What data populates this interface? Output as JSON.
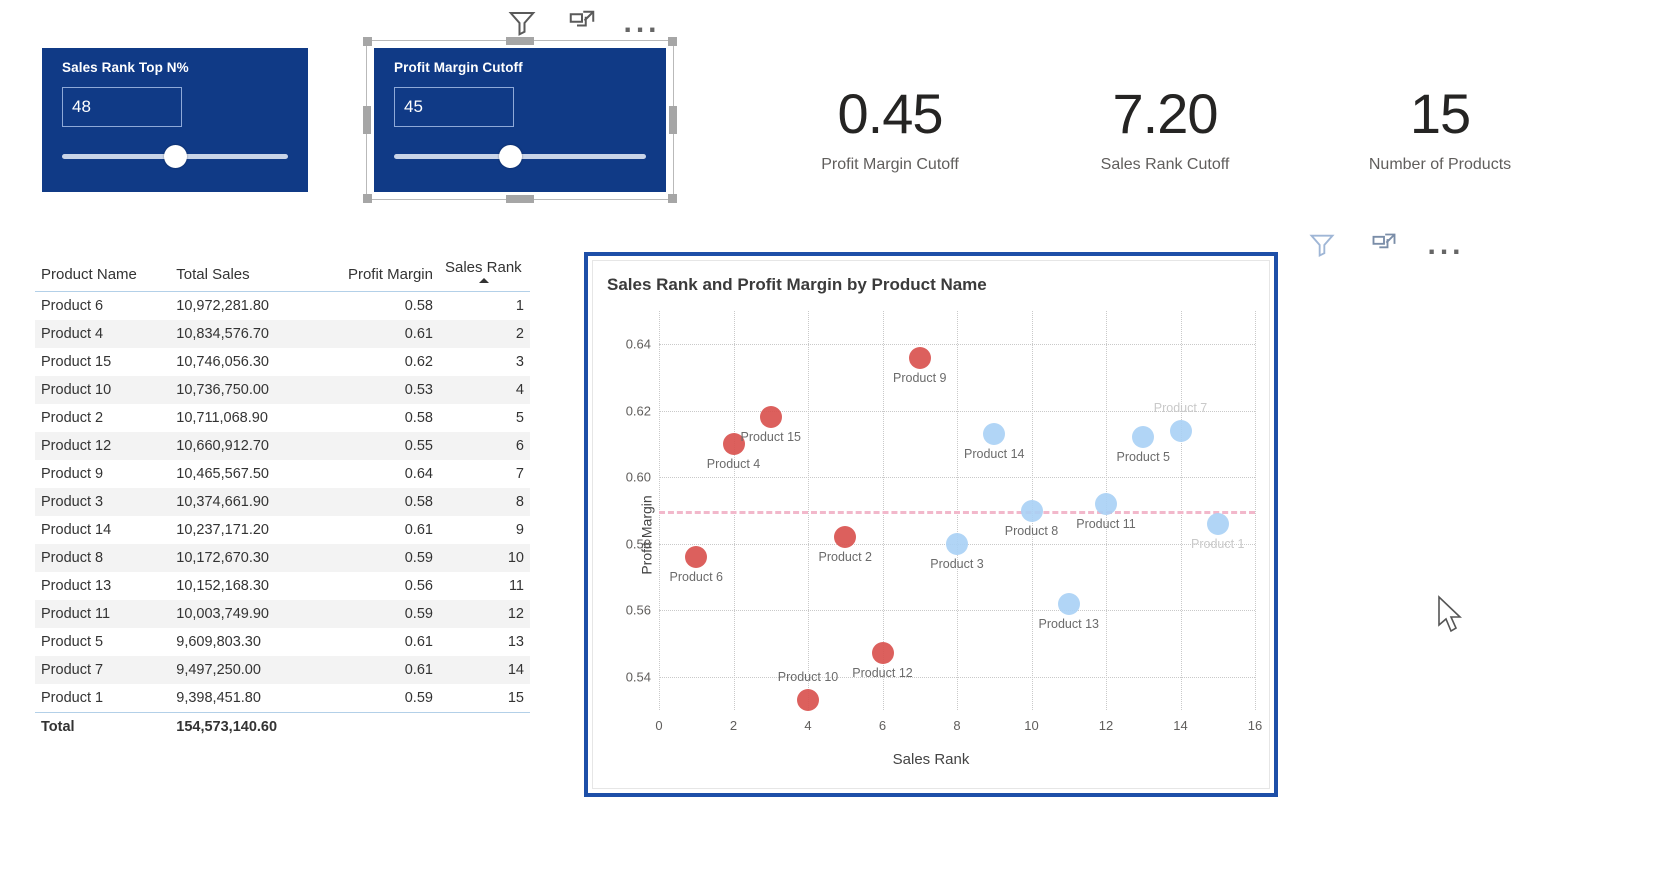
{
  "slicers": [
    {
      "title": "Sales Rank Top N%",
      "value": "48",
      "knob_pct": 50,
      "selected": false
    },
    {
      "title": "Profit Margin Cutoff",
      "value": "45",
      "knob_pct": 46,
      "selected": true
    }
  ],
  "slicer_toolbar": {
    "filter_icon": "filter-icon",
    "focus_icon": "focus-mode-icon",
    "more_icon": "more-options-icon",
    "more_label": "..."
  },
  "chart_toolbar": {
    "filter_icon": "filter-icon",
    "focus_icon": "focus-mode-icon",
    "more_label": "..."
  },
  "kpis": [
    {
      "value": "0.45",
      "label": "Profit Margin Cutoff"
    },
    {
      "value": "7.20",
      "label": "Sales Rank Cutoff"
    },
    {
      "value": "15",
      "label": "Number of Products"
    }
  ],
  "table": {
    "columns": [
      "Product Name",
      "Total Sales",
      "Profit Margin",
      "Sales Rank"
    ],
    "sorted_column": "Sales Rank",
    "sort_direction": "asc",
    "rows": [
      [
        "Product 6",
        "10,972,281.80",
        "0.58",
        "1"
      ],
      [
        "Product 4",
        "10,834,576.70",
        "0.61",
        "2"
      ],
      [
        "Product 15",
        "10,746,056.30",
        "0.62",
        "3"
      ],
      [
        "Product 10",
        "10,736,750.00",
        "0.53",
        "4"
      ],
      [
        "Product 2",
        "10,711,068.90",
        "0.58",
        "5"
      ],
      [
        "Product 12",
        "10,660,912.70",
        "0.55",
        "6"
      ],
      [
        "Product 9",
        "10,465,567.50",
        "0.64",
        "7"
      ],
      [
        "Product 3",
        "10,374,661.90",
        "0.58",
        "8"
      ],
      [
        "Product 14",
        "10,237,171.20",
        "0.61",
        "9"
      ],
      [
        "Product 8",
        "10,172,670.30",
        "0.59",
        "10"
      ],
      [
        "Product 13",
        "10,152,168.30",
        "0.56",
        "11"
      ],
      [
        "Product 11",
        "10,003,749.90",
        "0.59",
        "12"
      ],
      [
        "Product 5",
        "9,609,803.30",
        "0.61",
        "13"
      ],
      [
        "Product 7",
        "9,497,250.00",
        "0.61",
        "14"
      ],
      [
        "Product 1",
        "9,398,451.80",
        "0.59",
        "15"
      ]
    ],
    "total": {
      "label": "Total",
      "total_sales": "154,573,140.60",
      "profit_margin": "",
      "sales_rank": ""
    }
  },
  "chart_data": {
    "type": "scatter",
    "title": "Sales Rank and Profit Margin by Product Name",
    "xlabel": "Sales Rank",
    "ylabel": "Profit Margin",
    "xlim": [
      0,
      16
    ],
    "ylim": [
      0.53,
      0.65
    ],
    "xticks": [
      0,
      2,
      4,
      6,
      8,
      10,
      12,
      14,
      16
    ],
    "yticks": [
      0.54,
      0.56,
      0.58,
      0.6,
      0.62,
      0.64
    ],
    "grid": true,
    "legend": "none",
    "reference_line": {
      "value": 0.59,
      "color": "#f2b8cb",
      "style": "dashed",
      "label": "Profit Margin Cutoff"
    },
    "colors": {
      "above_cutoff": "#d9534f",
      "below_cutoff": "#a9d0f5"
    },
    "points": [
      {
        "label": "Product 6",
        "x": 1,
        "y": 0.576,
        "group": "above_cutoff",
        "label_pos": "below"
      },
      {
        "label": "Product 4",
        "x": 2,
        "y": 0.61,
        "group": "above_cutoff",
        "label_pos": "below"
      },
      {
        "label": "Product 15",
        "x": 3,
        "y": 0.618,
        "group": "above_cutoff",
        "label_pos": "below"
      },
      {
        "label": "Product 10",
        "x": 4,
        "y": 0.533,
        "group": "above_cutoff",
        "label_pos": "above"
      },
      {
        "label": "Product 2",
        "x": 5,
        "y": 0.582,
        "group": "above_cutoff",
        "label_pos": "below"
      },
      {
        "label": "Product 12",
        "x": 6,
        "y": 0.547,
        "group": "above_cutoff",
        "label_pos": "below"
      },
      {
        "label": "Product 9",
        "x": 7,
        "y": 0.636,
        "group": "above_cutoff",
        "label_pos": "below"
      },
      {
        "label": "Product 3",
        "x": 8,
        "y": 0.58,
        "group": "below_cutoff",
        "label_pos": "below"
      },
      {
        "label": "Product 14",
        "x": 9,
        "y": 0.613,
        "group": "below_cutoff",
        "label_pos": "below"
      },
      {
        "label": "Product 8",
        "x": 10,
        "y": 0.59,
        "group": "below_cutoff",
        "label_pos": "below"
      },
      {
        "label": "Product 13",
        "x": 11,
        "y": 0.562,
        "group": "below_cutoff",
        "label_pos": "below"
      },
      {
        "label": "Product 11",
        "x": 12,
        "y": 0.592,
        "group": "below_cutoff",
        "label_pos": "below"
      },
      {
        "label": "Product 5",
        "x": 13,
        "y": 0.612,
        "group": "below_cutoff",
        "label_pos": "below"
      },
      {
        "label": "Product 7",
        "x": 14,
        "y": 0.614,
        "group": "below_cutoff",
        "label_pos": "above"
      },
      {
        "label": "Product 1",
        "x": 15,
        "y": 0.586,
        "group": "below_cutoff",
        "label_pos": "below"
      }
    ]
  }
}
